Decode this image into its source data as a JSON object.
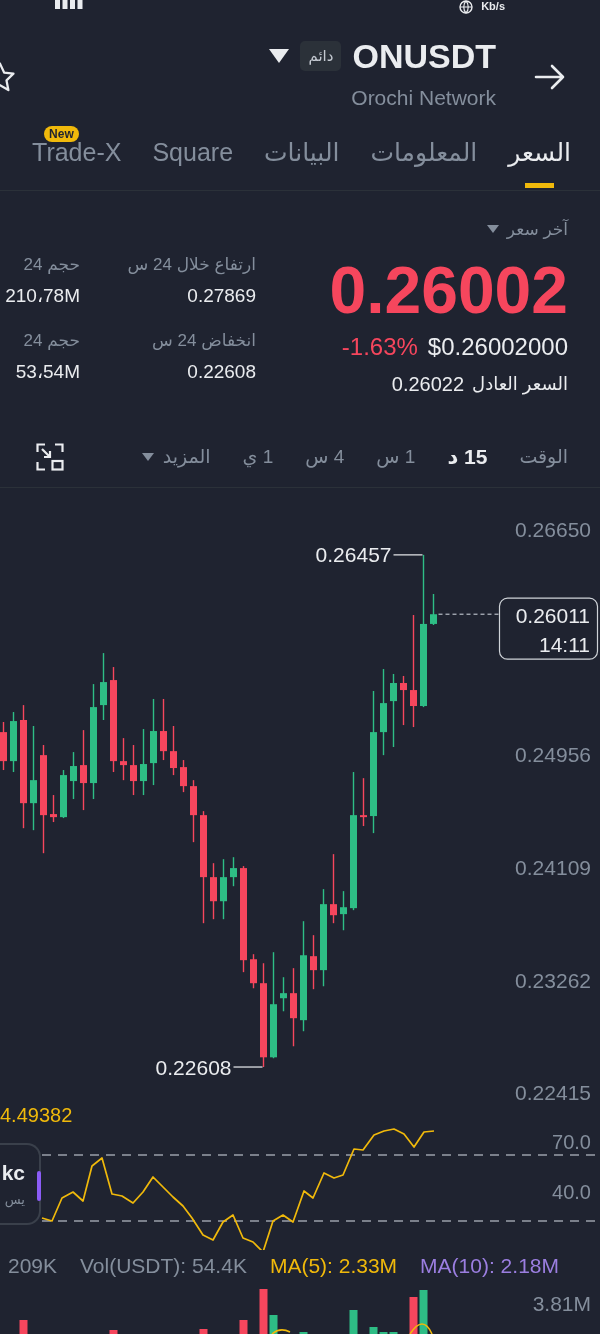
{
  "status_bar": {
    "speed_unit": "Kb/s"
  },
  "header": {
    "symbol": "ONUSDT",
    "contract_type": "دائم",
    "name": "Orochi Network"
  },
  "tabs": [
    {
      "label": "السعر",
      "selected": true
    },
    {
      "label": "المعلومات",
      "selected": false
    },
    {
      "label": "البيانات",
      "selected": false
    },
    {
      "label": "Square",
      "selected": false
    },
    {
      "label": "Trade-X",
      "selected": false,
      "badge": "New"
    }
  ],
  "price": {
    "label": "آخر سعر",
    "last": "0.26002",
    "falling": true,
    "usd": "$0.26002000",
    "change": "-1.63%",
    "fair_label": "السعر العادل",
    "fair": "0.26022"
  },
  "stats": [
    {
      "label": "ارتفاع خلال 24 س",
      "value": "0.27869"
    },
    {
      "label": "انخفاض 24 س",
      "value": "0.22608"
    }
  ],
  "volume_stats": [
    {
      "label": "حجم 24",
      "value": "210،78M"
    },
    {
      "label": "حجم 24",
      "value": "53،54M"
    }
  ],
  "timeframes": [
    {
      "label": "الوقت",
      "selected": false
    },
    {
      "label": "15 د",
      "selected": true
    },
    {
      "label": "1 س",
      "selected": false
    },
    {
      "label": "4 س",
      "selected": false
    },
    {
      "label": "1 ي",
      "selected": false
    }
  ],
  "more": "المزيد",
  "price_chart": {
    "chart_data": {
      "type": "candlestick",
      "categories": [
        null,
        null,
        null,
        null,
        null,
        null,
        null,
        null,
        null,
        null,
        null,
        null,
        null,
        null,
        null,
        null,
        null,
        null,
        null,
        null,
        null,
        null,
        null,
        null,
        null,
        null,
        null,
        null,
        null,
        null,
        null,
        null,
        null,
        null,
        null,
        null,
        null,
        null,
        null,
        null,
        null,
        null,
        null,
        null
      ],
      "ohlc": [
        [
          0.25125,
          0.25201,
          0.2484,
          0.24907
        ],
        [
          0.24907,
          0.25276,
          0.24825,
          0.25208
        ],
        [
          0.25216,
          0.25328,
          0.24403,
          0.24591
        ],
        [
          0.24591,
          0.25171,
          0.24388,
          0.24764
        ],
        [
          0.24952,
          0.25028,
          0.24215,
          0.24501
        ],
        [
          0.24509,
          0.24652,
          0.24449,
          0.24486
        ],
        [
          0.24486,
          0.2484,
          0.24479,
          0.24802
        ],
        [
          0.24757,
          0.24975,
          0.24622,
          0.2487
        ],
        [
          0.24877,
          0.2514,
          0.24539,
          0.24742
        ],
        [
          0.24742,
          0.25486,
          0.24622,
          0.25313
        ],
        [
          0.25328,
          0.25719,
          0.25216,
          0.25501
        ],
        [
          0.25516,
          0.25614,
          0.24825,
          0.24907
        ],
        [
          0.24907,
          0.2508,
          0.24764,
          0.24877
        ],
        [
          0.24877,
          0.25028,
          0.24652,
          0.24757
        ],
        [
          0.24757,
          0.25148,
          0.24652,
          0.24885
        ],
        [
          0.24892,
          0.25374,
          0.24727,
          0.25133
        ],
        [
          0.25133,
          0.25374,
          0.24915,
          0.24982
        ],
        [
          0.24982,
          0.25171,
          0.24802,
          0.24855
        ],
        [
          0.24862,
          0.24915,
          0.24674,
          0.24719
        ],
        [
          0.24719,
          0.24764,
          0.24298,
          0.24501
        ],
        [
          0.24501,
          0.24531,
          0.23689,
          0.24035
        ],
        [
          0.24035,
          0.2414,
          0.23719,
          0.23854
        ],
        [
          0.23854,
          0.2417,
          0.23719,
          0.24035
        ],
        [
          0.24035,
          0.24185,
          0.23967,
          0.24103
        ],
        [
          0.24103,
          0.24118,
          0.23321,
          0.23411
        ],
        [
          0.23418,
          0.23456,
          0.232,
          0.23238
        ],
        [
          0.23238,
          0.23388,
          0.22608,
          0.22681
        ],
        [
          0.22681,
          0.23471,
          0.22674,
          0.2308
        ],
        [
          0.23125,
          0.23283,
          0.23027,
          0.23163
        ],
        [
          0.23163,
          0.23351,
          0.22764,
          0.22975
        ],
        [
          0.2296,
          0.23704,
          0.22877,
          0.23448
        ],
        [
          0.23441,
          0.23599,
          0.23193,
          0.23336
        ],
        [
          0.23336,
          0.23945,
          0.23215,
          0.23832
        ],
        [
          0.23832,
          0.24208,
          0.23689,
          0.23749
        ],
        [
          0.23757,
          0.2393,
          0.23636,
          0.23809
        ],
        [
          0.23802,
          0.24825,
          0.23787,
          0.24501
        ],
        [
          0.24501,
          0.24779,
          0.24419,
          0.24486
        ],
        [
          0.24494,
          0.25434,
          0.24366,
          0.25125
        ],
        [
          0.25125,
          0.25599,
          0.24952,
          0.25343
        ],
        [
          0.25358,
          0.25562,
          0.25013,
          0.25494
        ],
        [
          0.25494,
          0.25547,
          0.25178,
          0.25441
        ],
        [
          0.25441,
          0.26005,
          0.25163,
          0.25321
        ],
        [
          0.25321,
          0.26457,
          0.25313,
          0.25938
        ],
        [
          0.25938,
          0.26163,
          0.2593,
          0.26011
        ]
      ],
      "ylim": [
        0.22415,
        0.2665
      ],
      "yticks": [
        {
          "value": 0.2665,
          "label": "0.26650"
        },
        {
          "value": 0.24956,
          "label": "0.24956"
        },
        {
          "value": 0.24109,
          "label": "0.24109"
        },
        {
          "value": 0.23262,
          "label": "0.23262"
        },
        {
          "value": 0.22415,
          "label": "0.22415"
        }
      ],
      "annotations": [
        "0.26457",
        "0.22608"
      ]
    },
    "last_price": "0.26011",
    "countdown": "14:11"
  },
  "rsi": {
    "value": "4.49382",
    "levels": [
      "70.0",
      "40.0"
    ]
  },
  "floating_widget": {
    "title": "kc",
    "subtitle": "يس"
  },
  "volume_legend": [
    {
      "text": "MA(10): 2.18M",
      "color": "#9b7ee0"
    },
    {
      "text": "MA(5): 2.33M",
      "color": "#f0b90b"
    },
    {
      "text": "Vol(USDT): 54.4K",
      "color": "#848e9c"
    },
    {
      "text": "209K",
      "color": "#848e9c"
    }
  ],
  "volume_chart": {
    "max_label": "3.81M"
  }
}
